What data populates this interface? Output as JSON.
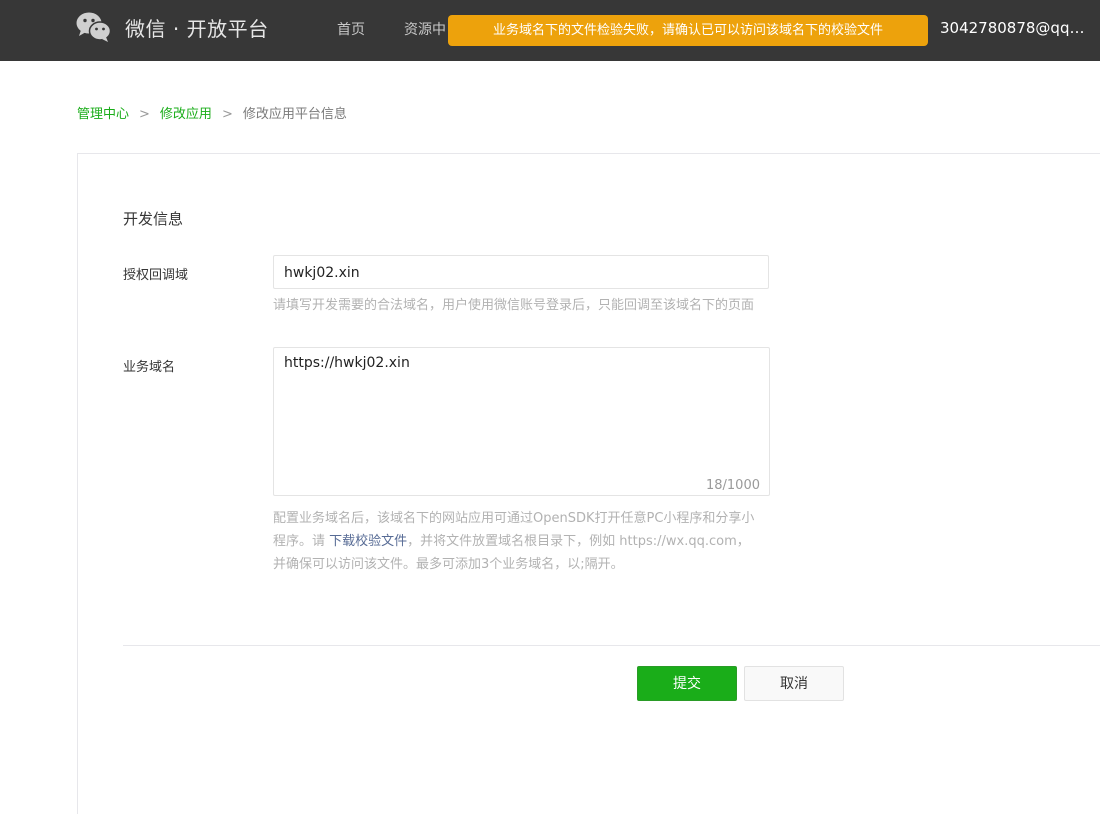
{
  "header": {
    "brand": "微信 · 开放平台",
    "nav": [
      "首页",
      "资源中"
    ],
    "toast": "业务域名下的文件检验失败，请确认已可以访问该域名下的校验文件",
    "account": "3042780878@qq.c..."
  },
  "breadcrumb": {
    "items": [
      "管理中心",
      "修改应用"
    ],
    "current": "修改应用平台信息",
    "separator": ">"
  },
  "form": {
    "section_title": "开发信息",
    "auth_domain": {
      "label": "授权回调域",
      "value": "hwkj02.xin",
      "hint": "请填写开发需要的合法域名，用户使用微信账号登录后，只能回调至该域名下的页面"
    },
    "biz_domain": {
      "label": "业务域名",
      "value": "https://hwkj02.xin",
      "counter": "18/1000",
      "hint_line1": "配置业务域名后，该域名下的网站应用可通过OpenSDK打开任意PC小程序和分享小",
      "hint_line2_prefix": "程序。请 ",
      "hint_link": "下载校验文件",
      "hint_line2_suffix": "，并将文件放置域名根目录下，例如 https://wx.qq.com，",
      "hint_line3": "并确保可以访问该文件。最多可添加3个业务域名，以;隔开。"
    },
    "submit_label": "提交",
    "cancel_label": "取消"
  },
  "colors": {
    "topbar": "#373737",
    "brand_green": "#1aad19",
    "toast": "#eda20c",
    "link": "#576b95"
  }
}
